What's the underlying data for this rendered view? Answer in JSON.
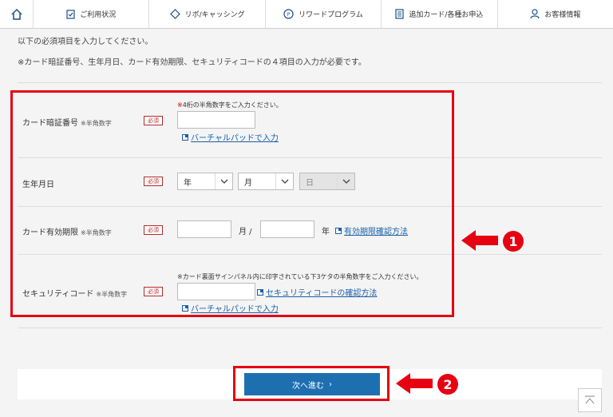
{
  "nav": {
    "home_icon": "home-icon",
    "items": [
      {
        "label": "ご利用状況",
        "icon": "clipboard-icon"
      },
      {
        "label": "リボ/キャッシング",
        "icon": "diamond-icon"
      },
      {
        "label": "リワードプログラム",
        "icon": "point-icon"
      },
      {
        "label": "追加カード/各種お申込",
        "icon": "document-icon"
      },
      {
        "label": "お客様情報",
        "icon": "user-icon"
      }
    ]
  },
  "intro": {
    "line1": "以下の必須項目を入力してください。",
    "line2": "※カード暗証番号、生年月日、カード有効期限、セキュリティコードの４項目の入力が必要です。"
  },
  "required_label": "必須",
  "pin": {
    "label": "カード暗証番号",
    "sub": "※半角数字",
    "hint_mark": "※",
    "hint": "4桁の半角数字をご入力ください。",
    "virtual_pad": "バーチャルパッドで入力"
  },
  "birth": {
    "label": "生年月日",
    "year": "年",
    "month": "月",
    "day": "日"
  },
  "expiry": {
    "label": "カード有効期限",
    "sub": "※半角数字",
    "month_sep": "月 /",
    "year_suffix": "年",
    "help_link": "有効期限確認方法"
  },
  "security": {
    "label": "セキュリティコード",
    "sub": "※半角数字",
    "hint": "※カード裏面サインパネル内に印字されている下3ケタの半角数字をご入力ください。",
    "help_link": "セキュリティコードの確認方法",
    "virtual_pad": "バーチャルパッドで入力"
  },
  "next_button": {
    "label": "次へ進む",
    "chevron": "›"
  },
  "annotations": {
    "badge1": "1",
    "badge2": "2"
  },
  "colors": {
    "accent": "#e60012",
    "button": "#1d6fb0",
    "link": "#1a5fa8"
  }
}
